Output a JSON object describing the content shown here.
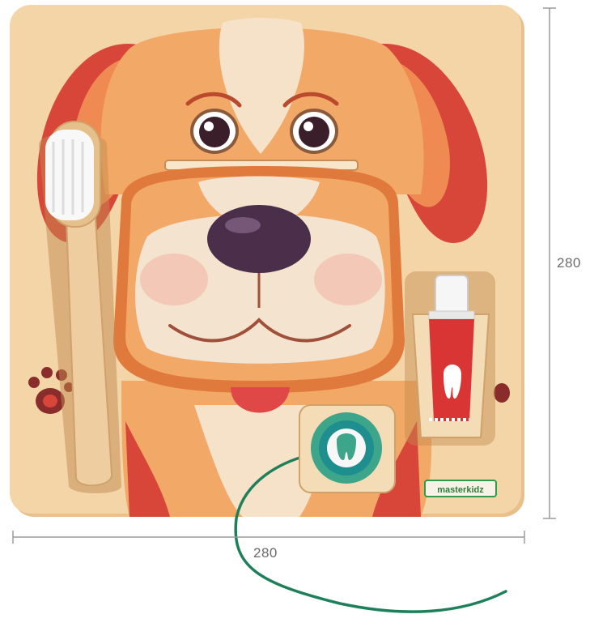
{
  "dimensions": {
    "width_label": "280",
    "height_label": "280"
  },
  "product": {
    "brand_label": "masterkidz"
  },
  "colors": {
    "board": "#f0d2a4",
    "fur": "#f2a867",
    "fur_dark": "#e07a3c",
    "ears": "#d8463a",
    "muzzle": "#f3e3cf",
    "nose": "#4a2e4a",
    "tongue": "#e04848",
    "toothpaste": "#d93535",
    "floss": "#3da58a",
    "brand_green": "#2e9a4a",
    "dimension_line": "#9a9a9a"
  },
  "icons": [
    "paw-print-icon",
    "tooth-icon"
  ]
}
